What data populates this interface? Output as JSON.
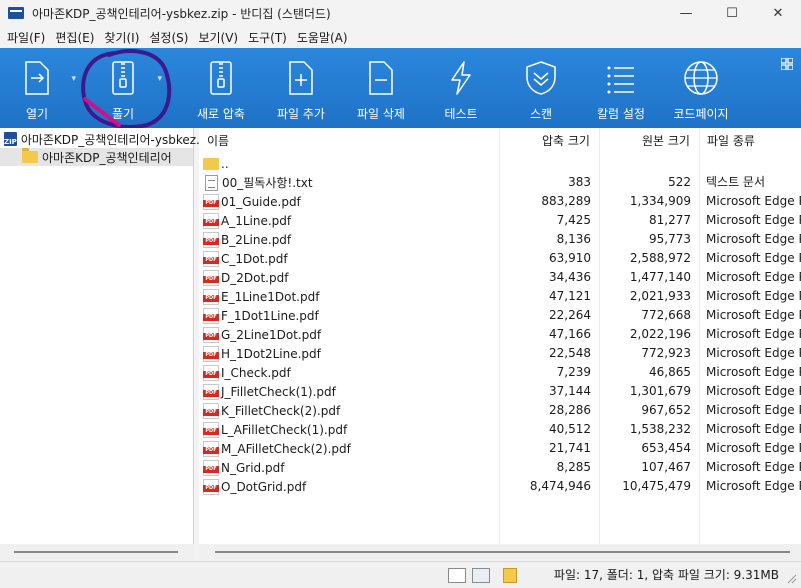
{
  "window": {
    "title": "아마존KDP_공책인테리어-ysbkez.zip - 반디집 (스탠더드)",
    "minimize": "—",
    "maximize": "☐",
    "close": "✕"
  },
  "menu": [
    "파일(F)",
    "편집(E)",
    "찾기(I)",
    "설정(S)",
    "보기(V)",
    "도구(T)",
    "도움말(A)"
  ],
  "toolbar": {
    "open": "열기",
    "extract": "풀기",
    "new_archive": "새로 압축",
    "add_file": "파일 추가",
    "delete_file": "파일 삭제",
    "test": "테스트",
    "scan": "스캔",
    "column_settings": "칼럼 설정",
    "codepage": "코드페이지"
  },
  "tree": {
    "zip_icon_text": "ZIP",
    "root": "아마존KDP_공책인테리어-ysbkez.zip",
    "folder": "아마존KDP_공책인테리어"
  },
  "columns": {
    "name": "이름",
    "compressed": "압축 크기",
    "original": "원본 크기",
    "type": "파일 종류"
  },
  "parent_dir": "..",
  "files": [
    {
      "name": "00_필독사항!.txt",
      "compressed": "383",
      "original": "522",
      "type": "텍스트 문서",
      "icon": "text-file-icon"
    },
    {
      "name": "01_Guide.pdf",
      "compressed": "883,289",
      "original": "1,334,909",
      "type": "Microsoft Edge PDF",
      "icon": "pdf-file-icon"
    },
    {
      "name": "A_1Line.pdf",
      "compressed": "7,425",
      "original": "81,277",
      "type": "Microsoft Edge PDF",
      "icon": "pdf-file-icon"
    },
    {
      "name": "B_2Line.pdf",
      "compressed": "8,136",
      "original": "95,773",
      "type": "Microsoft Edge PDF",
      "icon": "pdf-file-icon"
    },
    {
      "name": "C_1Dot.pdf",
      "compressed": "63,910",
      "original": "2,588,972",
      "type": "Microsoft Edge PDF",
      "icon": "pdf-file-icon"
    },
    {
      "name": "D_2Dot.pdf",
      "compressed": "34,436",
      "original": "1,477,140",
      "type": "Microsoft Edge PDF",
      "icon": "pdf-file-icon"
    },
    {
      "name": "E_1Line1Dot.pdf",
      "compressed": "47,121",
      "original": "2,021,933",
      "type": "Microsoft Edge PDF",
      "icon": "pdf-file-icon"
    },
    {
      "name": "F_1Dot1Line.pdf",
      "compressed": "22,264",
      "original": "772,668",
      "type": "Microsoft Edge PDF",
      "icon": "pdf-file-icon"
    },
    {
      "name": "G_2Line1Dot.pdf",
      "compressed": "47,166",
      "original": "2,022,196",
      "type": "Microsoft Edge PDF",
      "icon": "pdf-file-icon"
    },
    {
      "name": "H_1Dot2Line.pdf",
      "compressed": "22,548",
      "original": "772,923",
      "type": "Microsoft Edge PDF",
      "icon": "pdf-file-icon"
    },
    {
      "name": "I_Check.pdf",
      "compressed": "7,239",
      "original": "46,865",
      "type": "Microsoft Edge PDF",
      "icon": "pdf-file-icon"
    },
    {
      "name": "J_FilletCheck(1).pdf",
      "compressed": "37,144",
      "original": "1,301,679",
      "type": "Microsoft Edge PDF",
      "icon": "pdf-file-icon"
    },
    {
      "name": "K_FilletCheck(2).pdf",
      "compressed": "28,286",
      "original": "967,652",
      "type": "Microsoft Edge PDF",
      "icon": "pdf-file-icon"
    },
    {
      "name": "L_AFilletCheck(1).pdf",
      "compressed": "40,512",
      "original": "1,538,232",
      "type": "Microsoft Edge PDF",
      "icon": "pdf-file-icon"
    },
    {
      "name": "M_AFilletCheck(2).pdf",
      "compressed": "21,741",
      "original": "653,454",
      "type": "Microsoft Edge PDF",
      "icon": "pdf-file-icon"
    },
    {
      "name": "N_Grid.pdf",
      "compressed": "8,285",
      "original": "107,467",
      "type": "Microsoft Edge PDF",
      "icon": "pdf-file-icon"
    },
    {
      "name": "O_DotGrid.pdf",
      "compressed": "8,474,946",
      "original": "10,475,479",
      "type": "Microsoft Edge PDF",
      "icon": "pdf-file-icon"
    }
  ],
  "status": {
    "summary": "파일: 17, 폴더: 1, 압축 파일 크기: 9.31MB"
  },
  "colors": {
    "toolbar": "#2b87dc",
    "annotation_circle": "#3b1a8f",
    "annotation_arrow": "#d0108a"
  }
}
